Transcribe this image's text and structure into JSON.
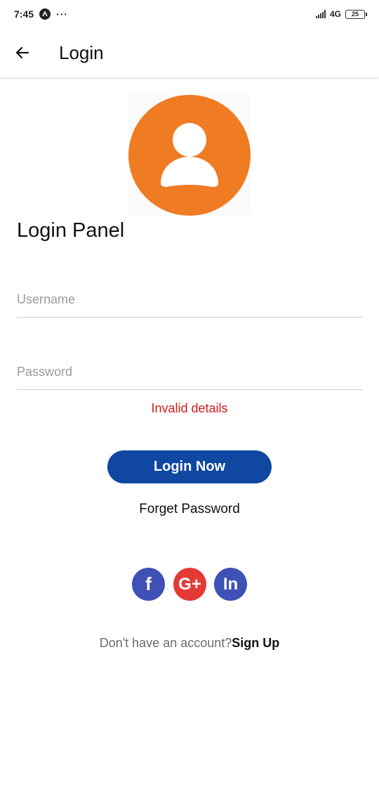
{
  "status_bar": {
    "time": "7:45",
    "overflow": "···",
    "network": "4G",
    "battery": "25"
  },
  "app_bar": {
    "title": "Login",
    "back_icon": "arrow-left-icon"
  },
  "avatar": {
    "icon": "person-icon",
    "color": "#ef7b23"
  },
  "panel": {
    "title": "Login Panel",
    "username_placeholder": "Username",
    "username_value": "",
    "password_placeholder": "Password",
    "password_value": "",
    "error_text": "Invalid details",
    "login_label": "Login Now",
    "forgot_label": "Forget Password"
  },
  "social": {
    "facebook_label": "f",
    "google_label": "G+",
    "linkedin_label": "In"
  },
  "signup": {
    "prompt": "Don't have an account?",
    "link": "Sign Up"
  },
  "colors": {
    "primary_button": "#0f47a1",
    "error": "#d11a1a",
    "facebook": "#3f51b5",
    "google": "#e53935",
    "linkedin": "#3f51b5"
  }
}
